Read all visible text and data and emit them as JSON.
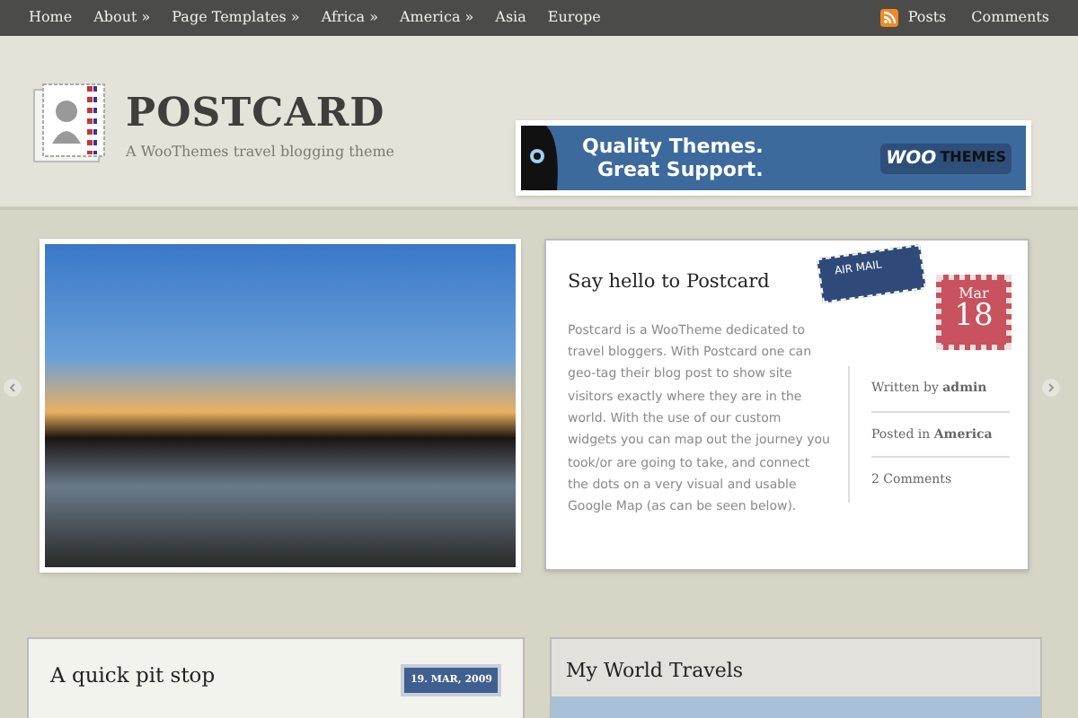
{
  "nav": {
    "items": [
      "Home",
      "About »",
      "Page Templates »",
      "Africa »",
      "America »",
      "Asia",
      "Europe"
    ],
    "right": [
      {
        "label": "Posts",
        "kind": "feed"
      },
      {
        "label": "Comments",
        "kind": "plain"
      }
    ]
  },
  "header": {
    "title": "POSTCARD",
    "tagline": "A WooThemes travel blogging theme",
    "banner": {
      "line_1": "Quality Themes.",
      "line_2": "Great Support.",
      "brand_1": "WOO",
      "brand_2": "THEMES"
    }
  },
  "featured": {
    "title": "Say hello to Postcard",
    "airmail": "AIR MAIL",
    "month": "Mar",
    "day": "18",
    "body": "Postcard is a WooTheme dedicated to travel bloggers. With Postcard one can geo-tag their blog post to show site visitors exactly where they are in the world. With the use of our custom widgets you can map out the journey you took/or are going to take, and connect the dots on a very visual and usable Google Map (as can be seen below).",
    "meta": [
      "Written by **admin**",
      "Posted in **America**",
      "2 Comments"
    ]
  },
  "post": {
    "title": "A quick pit stop",
    "date": "19. MAR, 2009"
  },
  "widget": {
    "title": "My World Travels"
  }
}
